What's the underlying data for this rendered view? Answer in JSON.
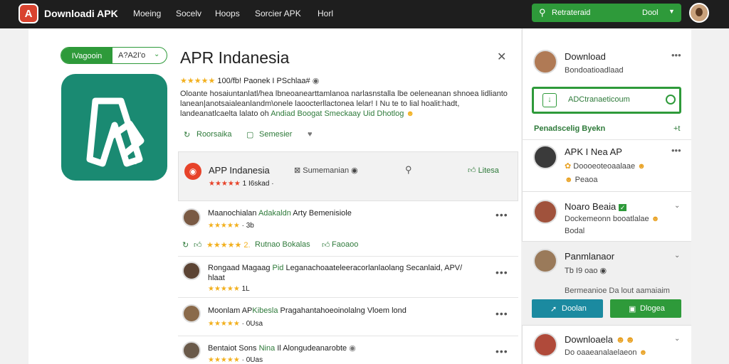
{
  "header": {
    "logo_text": "A",
    "brand": "Downloadi APK",
    "nav": [
      "Moeing",
      "Socelv",
      "Hoops",
      "Sorcier APK",
      "Horl"
    ],
    "search_label": "Retrateraid",
    "search_dropdown": "Dool"
  },
  "app": {
    "pill_left": "IVagooin",
    "pill_right": "A?A2I'o",
    "title": "APR Indanesia",
    "rating_stars": "★★★★★",
    "rating_text": "100/fb! Paonek I PSchlaa#",
    "desc_line1": "Oloante hosaiuntanlatl/hea lbneoanearttamlanoa narlasnstalla lbe  oeleneanan shnoea lidlianto",
    "desc_line2": "lanean|anotsaialeanlandm\\onele laoocterllactonea lelar! I               Nu te to lial hoalit:hadt,",
    "desc_line3_plain": "landeanatlcaelta lalato oh ",
    "desc_line3_link": "Andiad Boogat Smeckaay Uid Dhotlog",
    "actions": [
      "Roorsaika",
      "Semesier"
    ]
  },
  "featured": {
    "title": "APP Indanesia",
    "stars": "★★★★★",
    "count": "1 I6skad ·",
    "summary": "Sumemanian",
    "like": "Litesa"
  },
  "reviews": [
    {
      "name": "Maanochialan",
      "highlight": "Adakaldn",
      "rest": "Arty Bemenisiole",
      "stars": "★★★★★",
      "count": "3b"
    },
    {
      "name": "Rongaad Magaag",
      "highlight": "Pid",
      "rest": "Leganachoaateleeracorlanlaolang Secanlaid, APV/",
      "extra": "hlaat",
      "stars": "★★★★★",
      "count": "1L"
    },
    {
      "name": "Moonlam AP",
      "highlight": "Kibesla",
      "rest": "Pragahantahoeoinolalng Vloem lond",
      "stars": "★★★★★",
      "count": "0Usa"
    },
    {
      "name": "Bentaiot Sons",
      "highlight": "Nina",
      "rest": "Il Alongudeanarobte",
      "stars": "★★★★★",
      "count": "0Uas"
    }
  ],
  "review_actions": [
    "★★★★★ 2.",
    "Rutnao Bokalas",
    "Faoaoo"
  ],
  "sidebar": {
    "top": {
      "title": "Download",
      "sub": "Bondoatioadlaad"
    },
    "button": "ADCtranaeticoum",
    "section": "Penadscelig Byekn",
    "section_x": "+t",
    "cards": [
      {
        "title": "APK I Nea AP",
        "sub1": "Doooeoteoaalaae",
        "sub2": "Peaoa"
      },
      {
        "title": "Noaro Beaia",
        "sub1": "Dockemeonn booatlalae",
        "sub2": "Bodal"
      },
      {
        "title": "Panmlanaor",
        "sub1": "Tb I9 oao",
        "sub2": "Bermeanioe Da lout aamaiaim"
      },
      {
        "title": "Downloaela",
        "sub1": "Do oaaeanalaelaeon"
      }
    ],
    "btn_share": "Doolan",
    "btn_open": "Dlogea"
  }
}
